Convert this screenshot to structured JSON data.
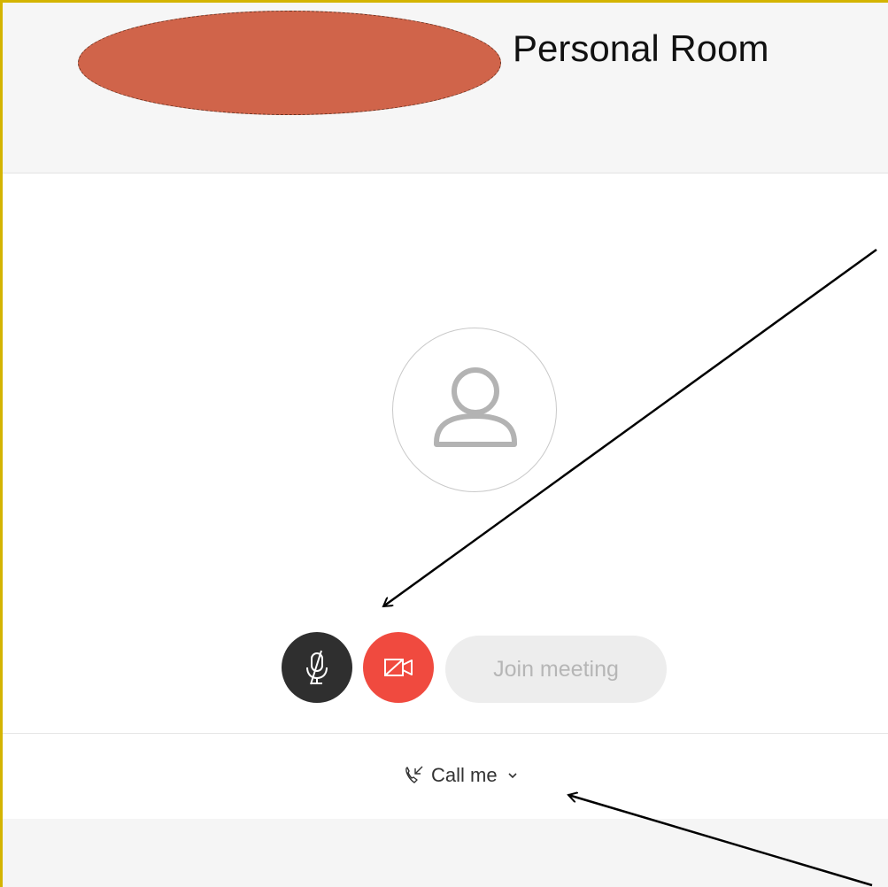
{
  "header": {
    "title": "Personal Room"
  },
  "controls": {
    "join_label": "Join meeting",
    "mute_icon": "microphone-muted-icon",
    "video_icon": "video-off-icon"
  },
  "call_options": {
    "label": "Call me",
    "phone_icon": "phone-incoming-icon",
    "chevron_icon": "chevron-down-icon"
  },
  "colors": {
    "mute_button": "#2f2f2f",
    "video_button": "#f04a3f",
    "join_button": "#ededed",
    "redaction": "#d0644a",
    "border_accent": "#d4b400"
  }
}
